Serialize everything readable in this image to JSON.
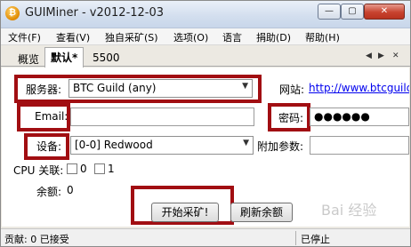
{
  "window": {
    "title": "GUIMiner - v2012-12-03",
    "minimize_glyph": "—",
    "maximize_glyph": "▢",
    "close_glyph": "✕"
  },
  "menu": [
    "文件(F)",
    "查看(V)",
    "独自采矿(S)",
    "选项(O)",
    "语言",
    "捐助(D)",
    "帮助(H)"
  ],
  "tabs": {
    "items": [
      "概览",
      "默认*",
      "5500"
    ],
    "active_index": 1,
    "nav_left": "◀",
    "nav_right": "▶",
    "nav_close": "✕"
  },
  "form": {
    "server_label": "服务器:",
    "server_value": "BTC Guild (any)",
    "website_label": "网站:",
    "website_link": "http://www.btcguild",
    "email_label": "Email:",
    "email_value": "",
    "password_label": "密码:",
    "password_value": "●●●●●●",
    "device_label": "设备:",
    "device_value": "[0-0] Redwood",
    "extra_params_label": "附加参数:",
    "extra_params_value": "",
    "cpu_affinity_label": "CPU 关联:",
    "cpu_options": [
      "0",
      "1"
    ],
    "balance_label": "余额:",
    "balance_value": "0",
    "start_button": "开始采矿!",
    "refresh_button": "刷新余额"
  },
  "status": {
    "shares": "贡献: 0 已接受",
    "state": "已停止"
  },
  "watermark_text": "Bai 经验",
  "colors": {
    "highlight_box": "#a10e12",
    "link": "#0000ee"
  }
}
